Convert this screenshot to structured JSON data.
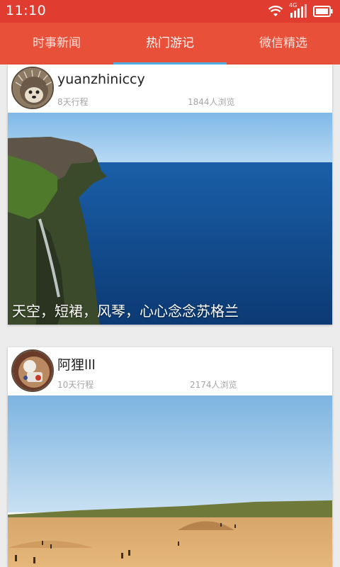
{
  "status_bar": {
    "time": "11:10",
    "network": "4G"
  },
  "tabs": [
    {
      "label": "时事新闻",
      "active": false
    },
    {
      "label": "热门游记",
      "active": true
    },
    {
      "label": "微信精选",
      "active": false
    }
  ],
  "posts": [
    {
      "username": "yuanzhiniccy",
      "days": "8天行程",
      "views": "1844人浏览",
      "caption": "天空，短裙，风琴，心心念念苏格兰"
    },
    {
      "username": "阿狸lll",
      "days": "10天行程",
      "views": "2174人浏览",
      "caption": ""
    }
  ],
  "colors": {
    "status_bar": "#e03c30",
    "tab_bar": "#e8503a",
    "tab_indicator": "#4fb3e8",
    "background": "#ececec"
  }
}
